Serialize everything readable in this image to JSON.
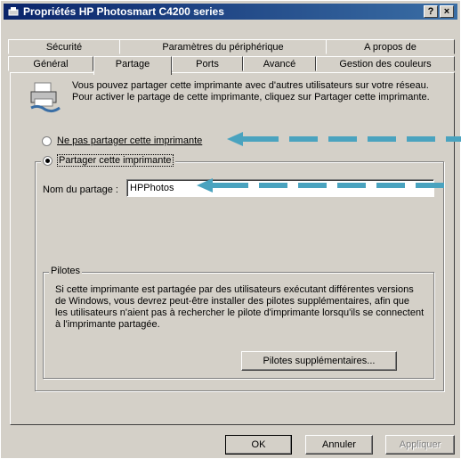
{
  "window": {
    "title": "Propriétés HP Photosmart C4200 series",
    "help": "?",
    "close": "×"
  },
  "tabs_back": [
    {
      "label": "Sécurité"
    },
    {
      "label": "Paramètres du périphérique"
    },
    {
      "label": "A propos de"
    }
  ],
  "tabs_front": [
    {
      "label": "Général"
    },
    {
      "label": "Partage"
    },
    {
      "label": "Ports"
    },
    {
      "label": "Avancé"
    },
    {
      "label": "Gestion des couleurs"
    }
  ],
  "info": {
    "text": "Vous pouvez partager cette imprimante avec d'autres utilisateurs sur votre réseau. Pour activer le partage de cette imprimante, cliquez sur Partager cette imprimante."
  },
  "options": {
    "no_share": "Ne pas partager cette imprimante",
    "share": "Partager cette imprimante",
    "selected": "share"
  },
  "share_name": {
    "label": "Nom du partage :",
    "value": "HPPhotos"
  },
  "drivers": {
    "title": "Pilotes",
    "text": "Si cette imprimante est partagée par des utilisateurs exécutant différentes versions de Windows, vous devrez peut-être installer des pilotes supplémentaires, afin que les utilisateurs n'aient pas à rechercher le pilote d'imprimante lorsqu'ils se connectent à l'imprimante partagée.",
    "button": "Pilotes supplémentaires..."
  },
  "footer": {
    "ok": "OK",
    "cancel": "Annuler",
    "apply": "Appliquer"
  },
  "annotation_color": "#4aa3bf"
}
